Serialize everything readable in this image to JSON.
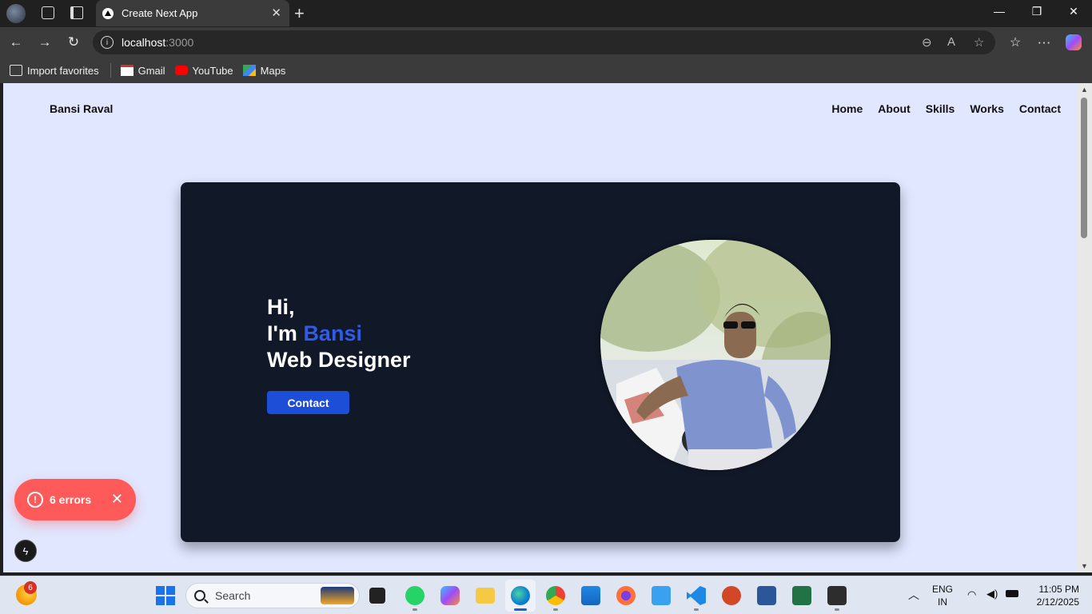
{
  "browser": {
    "tab_title": "Create Next App",
    "url_host": "localhost",
    "url_port": ":3000",
    "bookmarks": [
      "Import favorites",
      "Gmail",
      "YouTube",
      "Maps"
    ]
  },
  "site": {
    "brand": "Bansi Raval",
    "nav": [
      "Home",
      "About",
      "Skills",
      "Works",
      "Contact"
    ],
    "hero": {
      "line1": "Hi,",
      "im": "I'm ",
      "name": "Bansi",
      "role": "Web Designer",
      "cta": "Contact"
    },
    "colors": {
      "page_bg": "#e0e7ff",
      "card_bg": "#111827",
      "accent": "#1d4ed8"
    }
  },
  "devtools": {
    "errors_label": "6 errors"
  },
  "taskbar": {
    "search_placeholder": "Search",
    "weather_badge": "6",
    "lang": "ENG",
    "region": "IN",
    "time": "11:05 PM",
    "date": "2/12/2025"
  }
}
